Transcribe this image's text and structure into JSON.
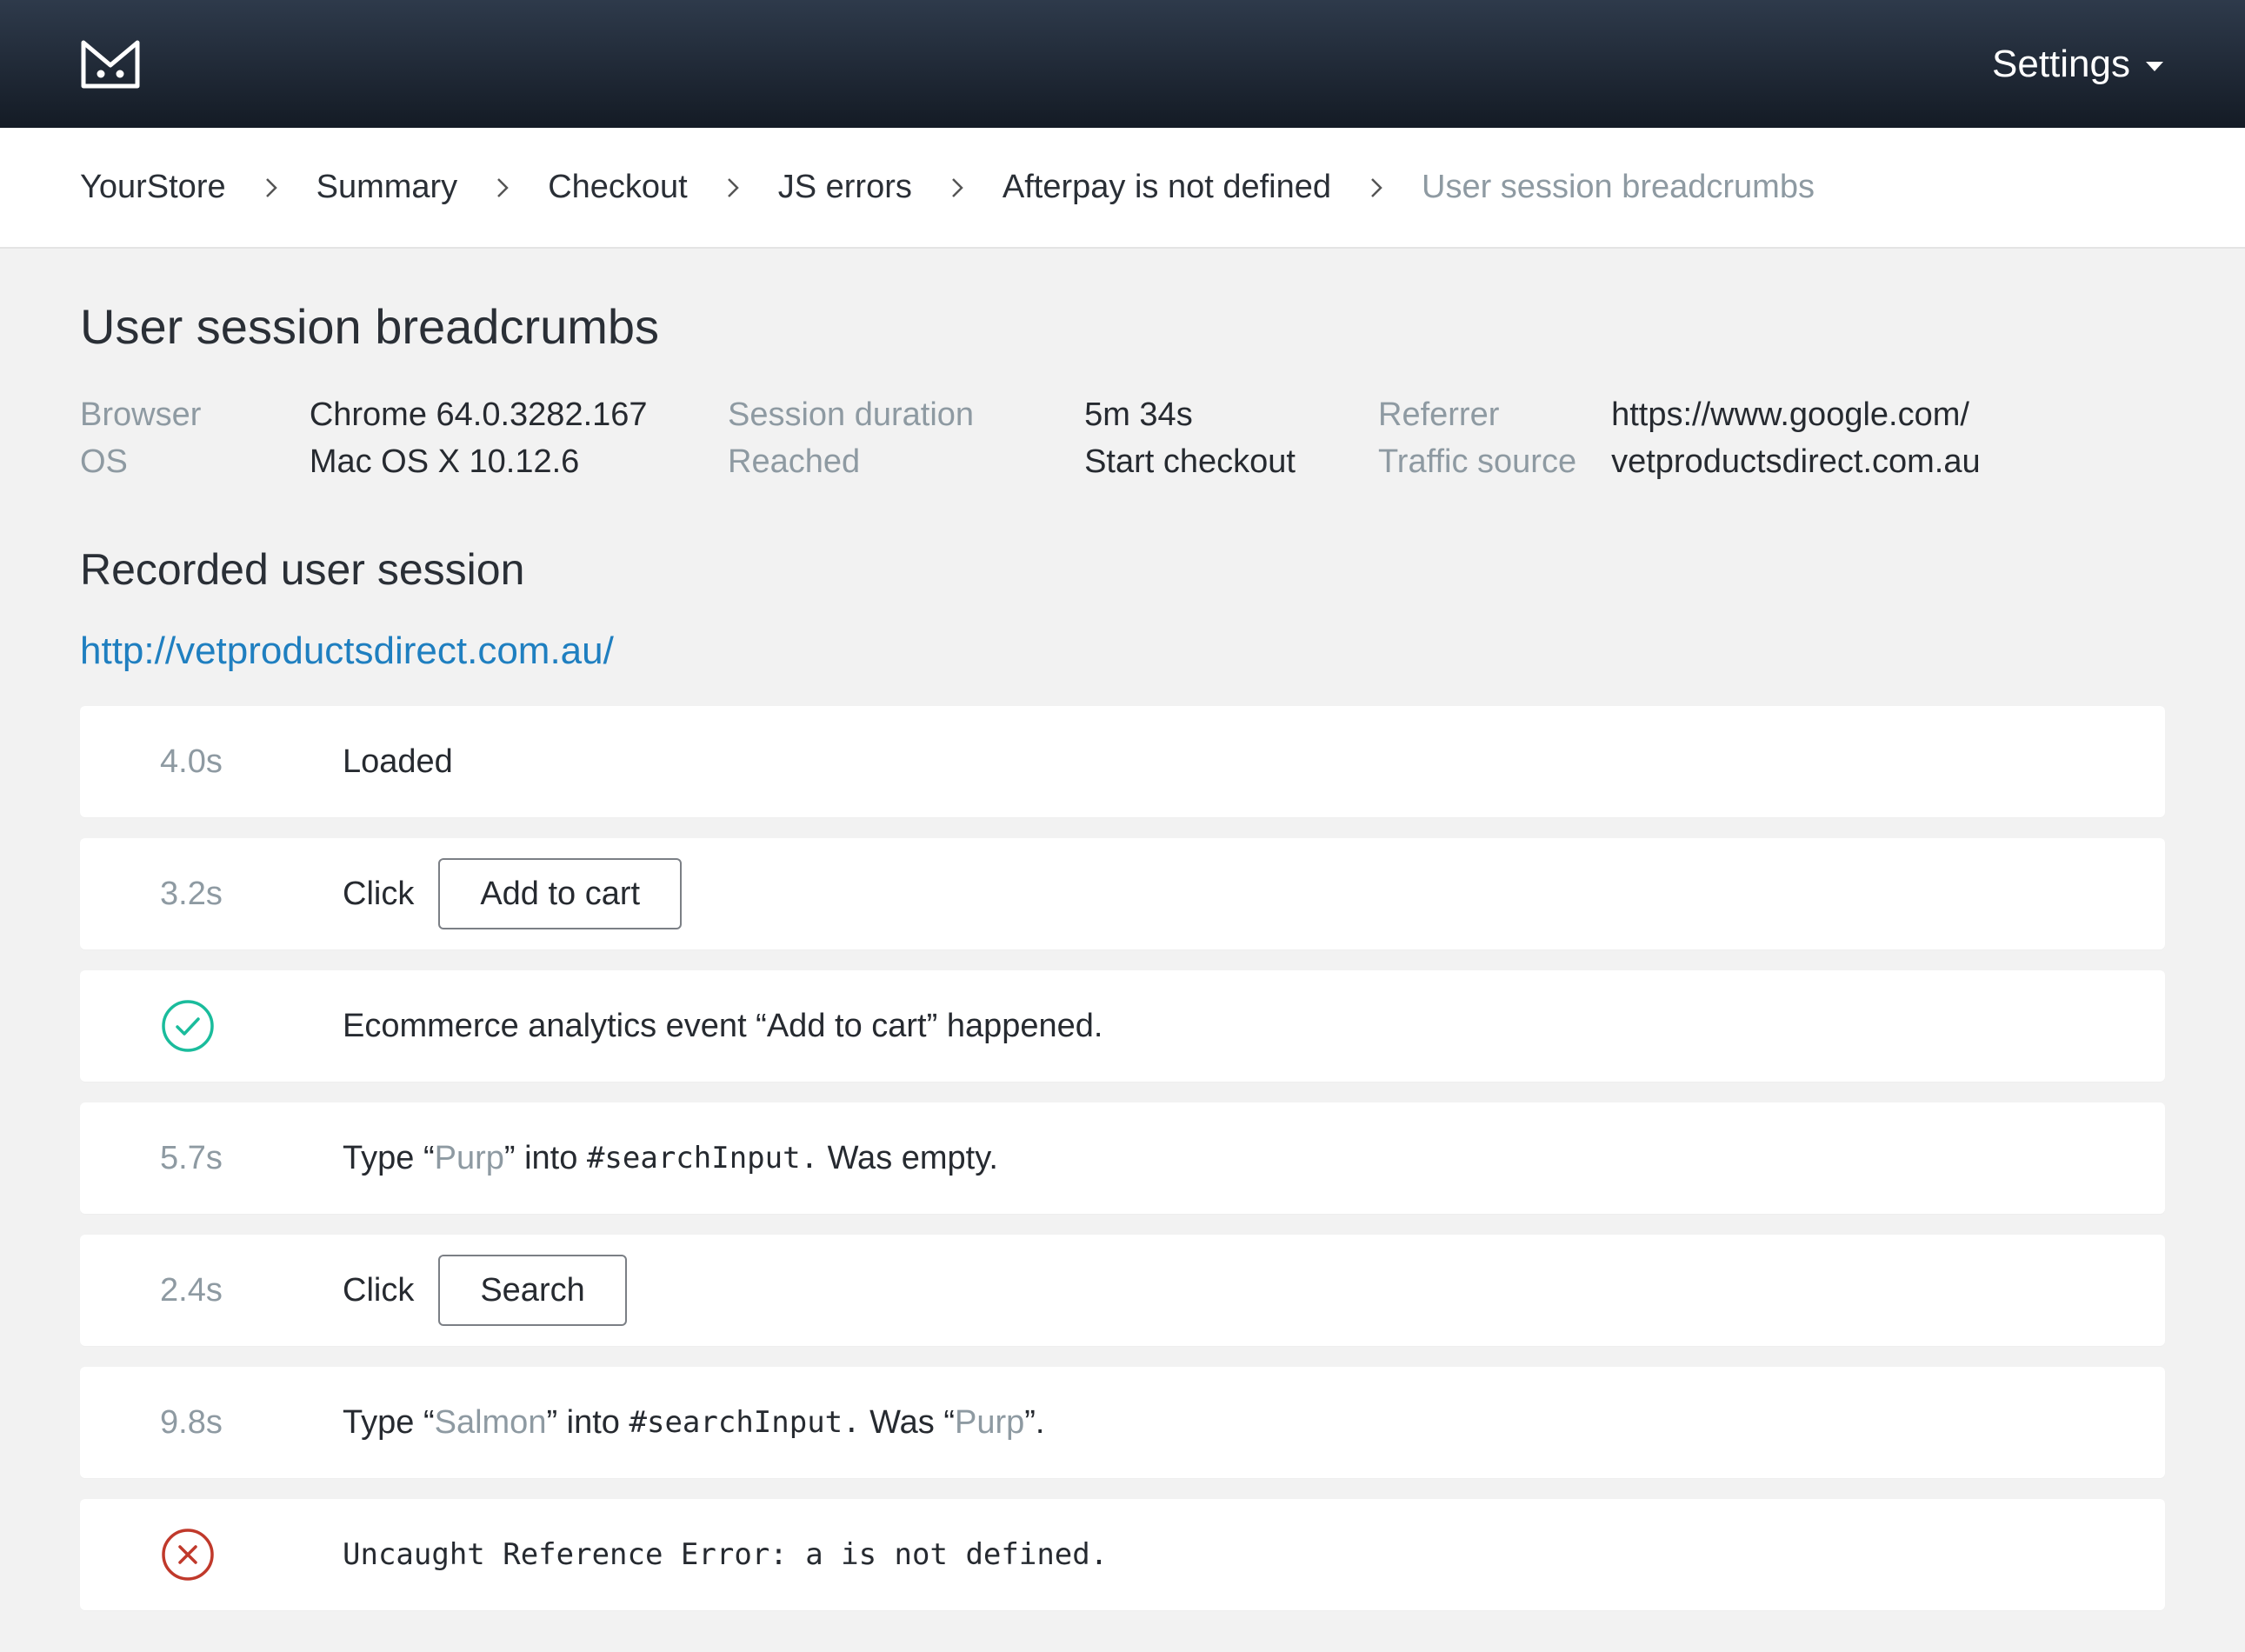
{
  "header": {
    "settings_label": "Settings"
  },
  "breadcrumbs": [
    "YourStore",
    "Summary",
    "Checkout",
    "JS errors",
    "Afterpay is not defined",
    "User session breadcrumbs"
  ],
  "page": {
    "title": "User session breadcrumbs"
  },
  "meta": {
    "browser_label": "Browser",
    "browser_value": "Chrome 64.0.3282.167",
    "os_label": "OS",
    "os_value": "Mac OS X 10.12.6",
    "duration_label": "Session duration",
    "duration_value": "5m 34s",
    "reached_label": "Reached",
    "reached_value": "Start checkout",
    "referrer_label": "Referrer",
    "referrer_value": "https://www.google.com/",
    "traffic_label": "Traffic source",
    "traffic_value": "vetproductsdirect.com.au"
  },
  "session": {
    "title": "Recorded user session",
    "url": "http://vetproductsdirect.com.au/"
  },
  "events": {
    "e1": {
      "time": "4.0s",
      "text": "Loaded"
    },
    "e2": {
      "time": "3.2s",
      "action": "Click",
      "button": "Add to cart"
    },
    "e3": {
      "icon": "check-circle-icon",
      "text": "Ecommerce analytics event “Add to cart”  happened."
    },
    "e4": {
      "time": "5.7s",
      "p1": "Type “",
      "value": "Purp",
      "p2": "” into ",
      "selector": "#searchInput.",
      "p3": " Was empty."
    },
    "e5": {
      "time": "2.4s",
      "action": "Click",
      "button": "Search"
    },
    "e6": {
      "time": "9.8s",
      "p1": "Type “",
      "value": "Salmon",
      "p2": "” into ",
      "selector": "#searchInput.",
      "p3": " Was “",
      "prev": "Purp",
      "p4": "”."
    },
    "e7": {
      "icon": "error-circle-icon",
      "text": "Uncaught Reference Error: a is not defined."
    }
  },
  "colors": {
    "success": "#1abc9c",
    "error": "#c0392b",
    "link": "#1f7fc0"
  }
}
